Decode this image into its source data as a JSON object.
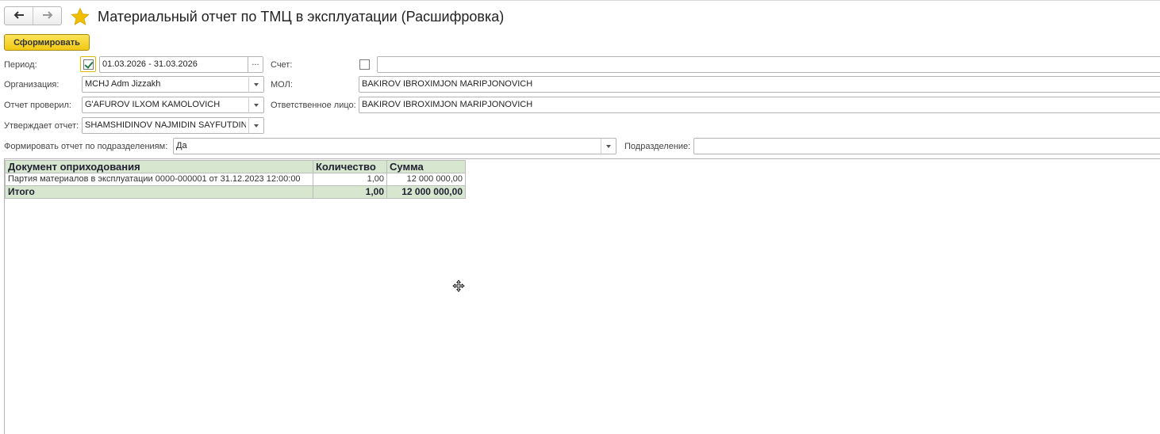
{
  "window": {
    "title": "Материальный отчет по ТМЦ в эксплуатации (Расшифровка)"
  },
  "toolbar": {
    "generate_label": "Сформировать"
  },
  "form": {
    "period": {
      "label": "Период:",
      "checked": true,
      "value": "01.03.2026 - 31.03.2026",
      "select_label": "..."
    },
    "account": {
      "label": "Счет:",
      "checked": false,
      "value": ""
    },
    "organization": {
      "label": "Организация:",
      "value": "MCHJ Adm Jizzakh"
    },
    "mol": {
      "label": "МОЛ:",
      "value": "BAKIROV IBROXIMJON MARIPJONOVICH"
    },
    "checked_by": {
      "label": "Отчет проверил:",
      "value": "G'AFUROV ILXOM KAMOLOVICH"
    },
    "responsible": {
      "label": "Ответственное лицо:",
      "value": "BAKIROV IBROXIMJON MARIPJONOVICH"
    },
    "approved_by": {
      "label": "Утверждает отчет:",
      "value": "SHAMSHIDINOV NAJMIDIN SAYFUTDINOVICH"
    },
    "by_division": {
      "label": "Формировать отчет по подразделениям:",
      "value": "Да"
    },
    "division": {
      "label": "Подразделение:",
      "value": ""
    }
  },
  "report": {
    "headers": [
      "Документ оприходования",
      "Количество",
      "Сумма"
    ],
    "rows": [
      {
        "document": "Партия материалов в эксплуатации 0000-000001 от 31.12.2023 12:00:00",
        "quantity": "1,00",
        "sum": "12 000 000,00"
      }
    ],
    "total": {
      "label": "Итого",
      "quantity": "1,00",
      "sum": "12 000 000,00"
    }
  },
  "colors": {
    "accent_button": "#f1c914",
    "table_header_bg": "#d6e6cf",
    "checkbox_check": "#1e7d43",
    "star": "#f0c000"
  },
  "icons": [
    "back-arrow-icon",
    "forward-arrow-icon",
    "favorite-star-icon",
    "dropdown-icon",
    "move-cursor-icon"
  ]
}
